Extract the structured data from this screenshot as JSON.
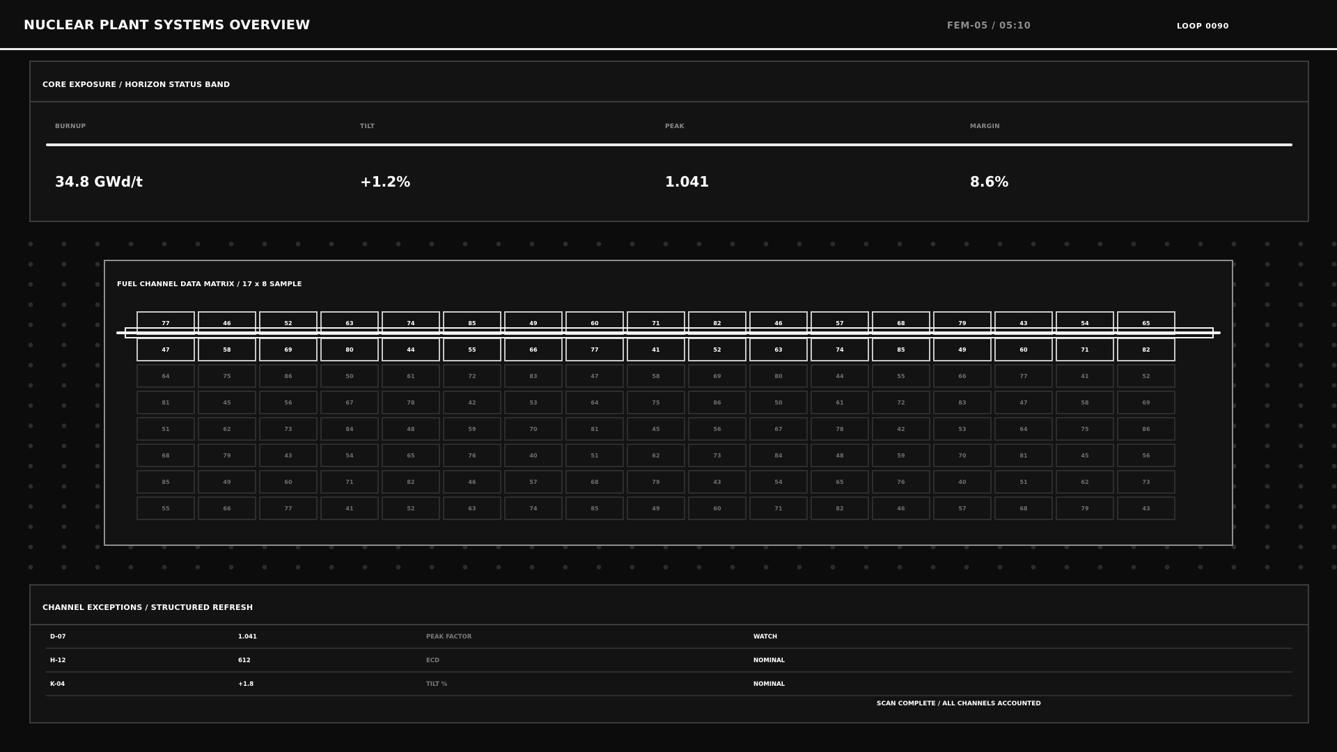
{
  "header": {
    "title": "NUCLEAR PLANT SYSTEMS OVERVIEW",
    "sector": "FEM-05  /  05:10",
    "loop": "LOOP 0090"
  },
  "core": {
    "title": "CORE EXPOSURE / HORIZON STATUS BAND",
    "metrics": [
      {
        "label": "BURNUP",
        "value": "34.8 GWd/t"
      },
      {
        "label": "TILT",
        "value": "+1.2%"
      },
      {
        "label": "PEAK",
        "value": "1.041"
      },
      {
        "label": "MARGIN",
        "value": "8.6%"
      }
    ]
  },
  "matrix": {
    "title": "FUEL CHANNEL DATA MATRIX / 17 x 8 SAMPLE",
    "highlighted_rows": [
      0,
      1
    ],
    "rows": [
      [
        "77",
        "46",
        "52",
        "63",
        "74",
        "85",
        "49",
        "60",
        "71",
        "82",
        "46",
        "57",
        "68",
        "79",
        "43",
        "54",
        "65"
      ],
      [
        "47",
        "58",
        "69",
        "80",
        "44",
        "55",
        "66",
        "77",
        "41",
        "52",
        "63",
        "74",
        "85",
        "49",
        "60",
        "71",
        "82"
      ],
      [
        "64",
        "75",
        "86",
        "50",
        "61",
        "72",
        "83",
        "47",
        "58",
        "69",
        "80",
        "44",
        "55",
        "66",
        "77",
        "41",
        "52"
      ],
      [
        "81",
        "45",
        "56",
        "67",
        "78",
        "42",
        "53",
        "64",
        "75",
        "86",
        "50",
        "61",
        "72",
        "83",
        "47",
        "58",
        "69"
      ],
      [
        "51",
        "62",
        "73",
        "84",
        "48",
        "59",
        "70",
        "81",
        "45",
        "56",
        "67",
        "78",
        "42",
        "53",
        "64",
        "75",
        "86"
      ],
      [
        "68",
        "79",
        "43",
        "54",
        "65",
        "76",
        "40",
        "51",
        "62",
        "73",
        "84",
        "48",
        "59",
        "70",
        "81",
        "45",
        "56"
      ],
      [
        "85",
        "49",
        "60",
        "71",
        "82",
        "46",
        "57",
        "68",
        "79",
        "43",
        "54",
        "65",
        "76",
        "40",
        "51",
        "62",
        "73"
      ],
      [
        "55",
        "66",
        "77",
        "41",
        "52",
        "63",
        "74",
        "85",
        "49",
        "60",
        "71",
        "82",
        "46",
        "57",
        "68",
        "79",
        "43"
      ]
    ]
  },
  "exceptions": {
    "title": "CHANNEL EXCEPTIONS / STRUCTURED REFRESH",
    "rows": [
      {
        "channel": "D-07",
        "value": "1.041",
        "metric": "PEAK FACTOR",
        "status": "WATCH"
      },
      {
        "channel": "H-12",
        "value": "612",
        "metric": "ECD",
        "status": "NOMINAL"
      },
      {
        "channel": "K-04",
        "value": "+1.8",
        "metric": "TILT %",
        "status": "NOMINAL"
      }
    ],
    "footer": "SCAN COMPLETE / ALL CHANNELS ACCOUNTED"
  }
}
